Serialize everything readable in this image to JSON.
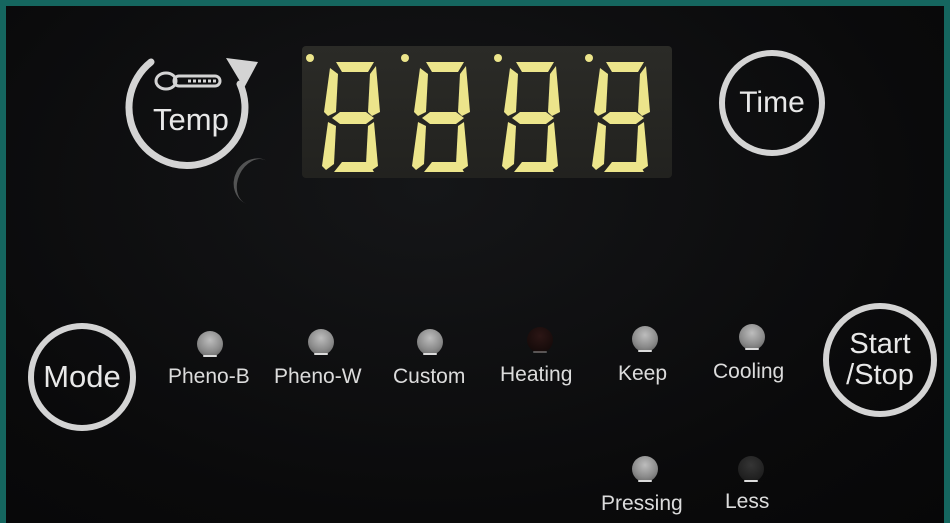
{
  "buttons": {
    "temp": "Temp",
    "time": "Time",
    "mode": "Mode",
    "start_stop_line1": "Start",
    "start_stop_line2": "/Stop"
  },
  "display": {
    "digits": [
      "8",
      "8",
      "8",
      "8"
    ],
    "color": "#ece58b"
  },
  "indicators": [
    {
      "label": "Pheno-B",
      "state": "off"
    },
    {
      "label": "Pheno-W",
      "state": "off"
    },
    {
      "label": "Custom",
      "state": "off"
    },
    {
      "label": "Heating",
      "state": "dark"
    },
    {
      "label": "Keep",
      "state": "off"
    },
    {
      "label": "Cooling",
      "state": "off"
    },
    {
      "label": "Pressing",
      "state": "off"
    },
    {
      "label": "Less",
      "state": "dim"
    }
  ],
  "colors": {
    "frame": "#15665f",
    "panel": "#0b0b0c",
    "button_ring": "#d4d4d4"
  }
}
